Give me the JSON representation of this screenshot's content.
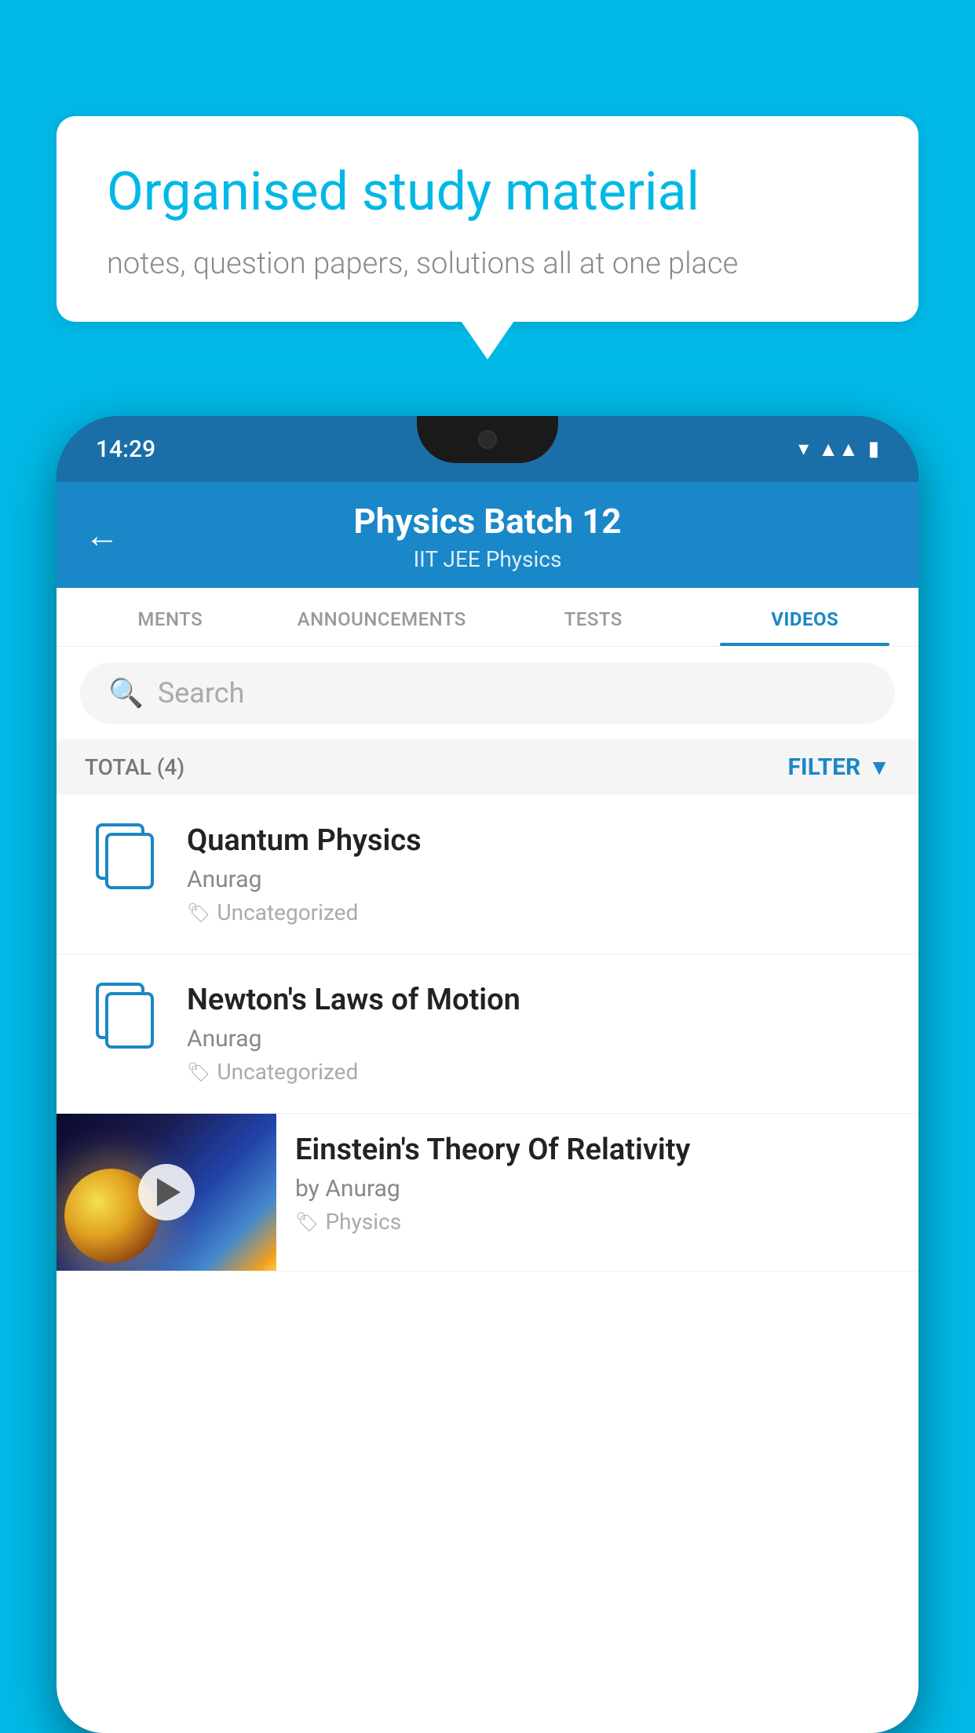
{
  "background": {
    "color": "#00b8e6"
  },
  "speechBubble": {
    "headline": "Organised study material",
    "subtext": "notes, question papers, solutions all at one place"
  },
  "phone": {
    "statusBar": {
      "time": "14:29"
    },
    "header": {
      "title": "Physics Batch 12",
      "subtitle": "IIT JEE    Physics"
    },
    "tabs": [
      {
        "label": "MENTS",
        "active": false
      },
      {
        "label": "ANNOUNCEMENTS",
        "active": false
      },
      {
        "label": "TESTS",
        "active": false
      },
      {
        "label": "VIDEOS",
        "active": true
      }
    ],
    "search": {
      "placeholder": "Search"
    },
    "filterBar": {
      "total": "TOTAL (4)",
      "filterLabel": "FILTER"
    },
    "videoList": [
      {
        "title": "Quantum Physics",
        "author": "Anurag",
        "tag": "Uncategorized",
        "hasThumb": false
      },
      {
        "title": "Newton's Laws of Motion",
        "author": "Anurag",
        "tag": "Uncategorized",
        "hasThumb": false
      },
      {
        "title": "Einstein's Theory Of Relativity",
        "author": "by Anurag",
        "tag": "Physics",
        "hasThumb": true
      }
    ]
  }
}
